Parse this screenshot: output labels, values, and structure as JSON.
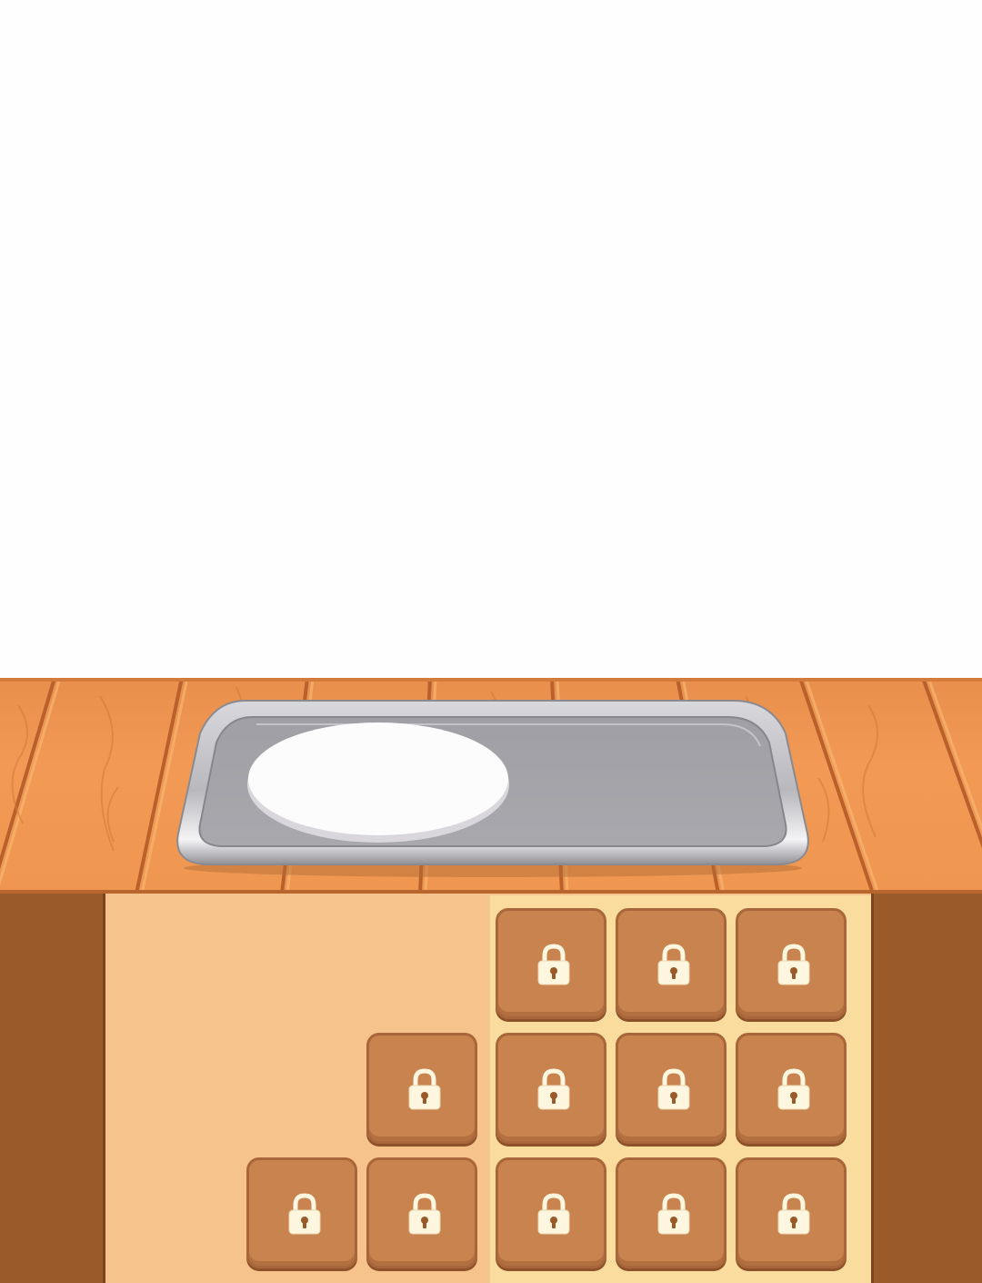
{
  "scene": {
    "type": "cooking-game",
    "background_color": "#fefefe",
    "counter_color": "#f29a55",
    "shelf_color": "#f7c38d",
    "post_color": "#9a5a2a"
  },
  "tray": {
    "icon": "serving-tray",
    "plate_icon": "empty-plate"
  },
  "ingredient_slots": [
    {
      "id": "slot-1",
      "icon": "lock-icon",
      "locked": true
    },
    {
      "id": "slot-2",
      "icon": "lock-icon",
      "locked": true
    },
    {
      "id": "slot-3",
      "icon": "lock-icon",
      "locked": true
    },
    {
      "id": "slot-4",
      "icon": "lock-icon",
      "locked": true
    },
    {
      "id": "slot-5",
      "icon": "lock-icon",
      "locked": true
    },
    {
      "id": "slot-6",
      "icon": "lock-icon",
      "locked": true
    },
    {
      "id": "slot-7",
      "icon": "lock-icon",
      "locked": true
    },
    {
      "id": "slot-8",
      "icon": "lock-icon",
      "locked": true
    },
    {
      "id": "slot-9",
      "icon": "lock-icon",
      "locked": true
    },
    {
      "id": "slot-10",
      "icon": "lock-icon",
      "locked": true
    },
    {
      "id": "slot-11",
      "icon": "lock-icon",
      "locked": true
    },
    {
      "id": "slot-12",
      "icon": "lock-icon",
      "locked": true
    },
    {
      "id": "slot-13",
      "icon": "lock-icon",
      "locked": true
    }
  ]
}
